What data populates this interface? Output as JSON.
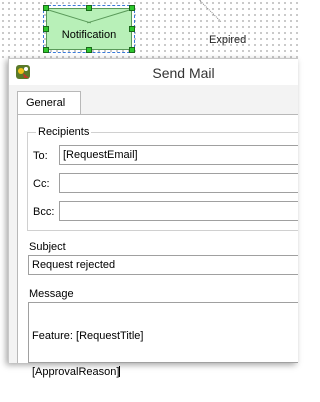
{
  "workflow": {
    "notification_label": "Notification",
    "expired_label": "Expired"
  },
  "dialog": {
    "title": "Send Mail",
    "icon": "workflow-app-icon",
    "tabs": [
      {
        "label": "General",
        "selected": true
      }
    ],
    "recipients": {
      "group_title": "Recipients",
      "to_label": "To:",
      "to_value": "[RequestEmail]",
      "cc_label": "Cc:",
      "cc_value": "",
      "bcc_label": "Bcc:",
      "bcc_value": ""
    },
    "subject": {
      "label": "Subject",
      "value": "Request rejected"
    },
    "message": {
      "label": "Message",
      "line1": "Feature: [RequestTitle]",
      "line2": "[ApprovalReason]"
    }
  },
  "colors": {
    "node_fill": "#b8f0b8",
    "handle": "#2ec82e",
    "selection": "#3a7ad8"
  }
}
